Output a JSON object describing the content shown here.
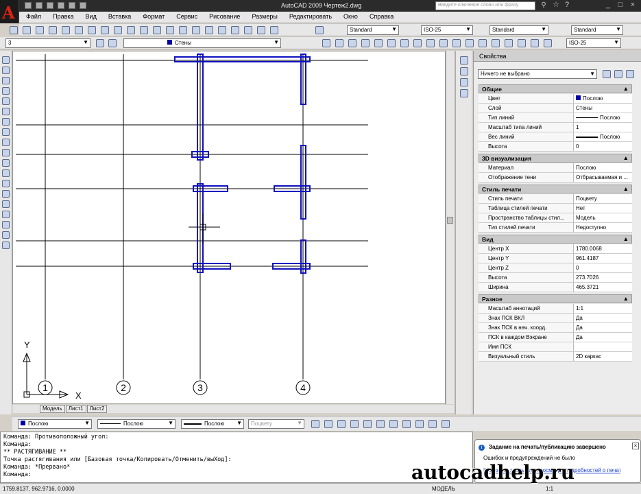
{
  "app": {
    "title": "AutoCAD 2009 Чертеж2.dwg",
    "logo": "A"
  },
  "search": {
    "placeholder": "Введите ключевое слово или фразу"
  },
  "menu": [
    "Файл",
    "Правка",
    "Вид",
    "Вставка",
    "Формат",
    "Сервис",
    "Рисование",
    "Размеры",
    "Редактировать",
    "Окно",
    "Справка"
  ],
  "toolbar": {
    "textstyle": "Standard",
    "dimstyle": "ISO-25",
    "tablestyle": "Standard",
    "mleaderstyle": "Standard",
    "workspace": "3",
    "layer": "Стены",
    "dimstyle2": "ISO-25"
  },
  "drawing": {
    "axis_labels": [
      "1",
      "2",
      "3",
      "4"
    ],
    "ucs": {
      "x": "X",
      "y": "Y"
    }
  },
  "tabs": [
    "Модель",
    "Лист1",
    "Лист2"
  ],
  "properties": {
    "title": "Свойства",
    "selection": "Ничего не выбрано",
    "sections": [
      {
        "name": "Общие",
        "rows": [
          [
            "Цвет",
            "Послою"
          ],
          [
            "Слой",
            "Стены"
          ],
          [
            "Тип линий",
            "Послою"
          ],
          [
            "Масштаб типа линий",
            "1"
          ],
          [
            "Вес линий",
            "Послою"
          ],
          [
            "Высота",
            "0"
          ]
        ]
      },
      {
        "name": "3D визуализация",
        "rows": [
          [
            "Материал",
            "Послою"
          ],
          [
            "Отображение тени",
            "Отбрасываемая и ..."
          ]
        ]
      },
      {
        "name": "Стиль печати",
        "rows": [
          [
            "Стиль печати",
            "Поцвету"
          ],
          [
            "Таблица стилей печати",
            "Нет"
          ],
          [
            "Пространство таблицы стил...",
            "Модель"
          ],
          [
            "Тип стилей печати",
            "Недоступно"
          ]
        ]
      },
      {
        "name": "Вид",
        "rows": [
          [
            "Центр X",
            "1780.0068"
          ],
          [
            "Центр Y",
            "961.4187"
          ],
          [
            "Центр Z",
            "0"
          ],
          [
            "Высота",
            "273.7026"
          ],
          [
            "Ширина",
            "465.3721"
          ]
        ]
      },
      {
        "name": "Разное",
        "rows": [
          [
            "Масштаб аннотаций",
            "1:1"
          ],
          [
            "Знак ПСК ВКЛ",
            "Да"
          ],
          [
            "Знак ПСК в нач. коорд.",
            "Да"
          ],
          [
            "ПСК в каждом Вэкране",
            "Да"
          ],
          [
            "Имя ПСК",
            ""
          ],
          [
            "Визуальный стиль",
            "2D каркас"
          ]
        ]
      }
    ]
  },
  "layerbar": {
    "color": "Послою",
    "linetype": "Послою",
    "lineweight": "Послою",
    "plotstyle": "Поцвету"
  },
  "command_lines": [
    "Команда: Противоположный угол:",
    "Команда:",
    "** РАСТЯГИВАНИЕ **",
    "Точка растягивания или [Базовая точка/Копировать/Отменить/выХод]:",
    "Команда: *Прервано*",
    "Команда:"
  ],
  "status": {
    "coords": "1759.8137, 962.9716, 0.0000",
    "model": "МОДЕЛЬ",
    "scale": "1:1"
  },
  "balloon": {
    "title": "Задание на печать/публикацию завершено",
    "line1": "Ошибок и предупреждений не было",
    "link": "Щелкните здесь для просмотра подробностей о печати/публикации..."
  },
  "watermark": "autocadhelp.ru",
  "colors": {
    "wall": "#1010c0",
    "layer_swatch": "#0000aa"
  }
}
